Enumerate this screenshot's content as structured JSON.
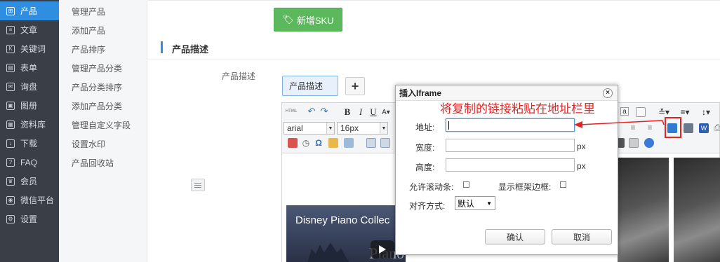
{
  "nav": {
    "items": [
      {
        "label": "产品",
        "icon": "grid-icon",
        "glyph": "⊞",
        "active": true
      },
      {
        "label": "文章",
        "icon": "document-icon",
        "glyph": "≡"
      },
      {
        "label": "关键词",
        "icon": "k-icon",
        "glyph": "K"
      },
      {
        "label": "表单",
        "icon": "form-icon",
        "glyph": "▤"
      },
      {
        "label": "询盘",
        "icon": "inquiry-icon",
        "glyph": "✉"
      },
      {
        "label": "图册",
        "icon": "album-icon",
        "glyph": "▣"
      },
      {
        "label": "资料库",
        "icon": "database-icon",
        "glyph": "▦"
      },
      {
        "label": "下载",
        "icon": "download-icon",
        "glyph": "↓"
      },
      {
        "label": "FAQ",
        "icon": "question-icon",
        "glyph": "?"
      },
      {
        "label": "会员",
        "icon": "crown-icon",
        "glyph": "♛"
      },
      {
        "label": "微信平台",
        "icon": "wechat-icon",
        "glyph": "◉"
      },
      {
        "label": "设置",
        "icon": "gear-icon",
        "glyph": "⚙"
      }
    ]
  },
  "subnav": {
    "items": [
      "管理产品",
      "添加产品",
      "产品排序",
      "管理产品分类",
      "产品分类排序",
      "添加产品分类",
      "管理自定义字段",
      "设置水印",
      "产品回收站"
    ]
  },
  "main": {
    "sku_button": "新增SKU",
    "section_title": "产品描述",
    "field_label": "产品描述",
    "desc_tab": "产品描述",
    "add_tab": "+"
  },
  "editor": {
    "font_family": "arial",
    "font_size": "16px",
    "html_label": "HTML",
    "bold": "B",
    "italic": "I",
    "underline": "U",
    "video_title": "Disney Piano Collec",
    "video_sub": "Piano"
  },
  "dialog": {
    "title": "插入Iframe",
    "close": "×",
    "address_label": "地址:",
    "address_value": "",
    "width_label": "宽度:",
    "width_value": "",
    "height_label": "高度:",
    "height_value": "",
    "unit": "px",
    "scroll_label": "允许滚动条:",
    "border_label": "显示框架边框:",
    "align_label": "对齐方式:",
    "align_value": "默认",
    "confirm": "确认",
    "cancel": "取消"
  },
  "annotation": {
    "text": "将复制的链接粘贴在地址栏里",
    "color": "#e62222"
  },
  "colors": {
    "nav_bg": "#3a3f47",
    "nav_active": "#2f8ee0",
    "sku_green": "#5cb85c",
    "accent_blue": "#2f8ee0"
  }
}
